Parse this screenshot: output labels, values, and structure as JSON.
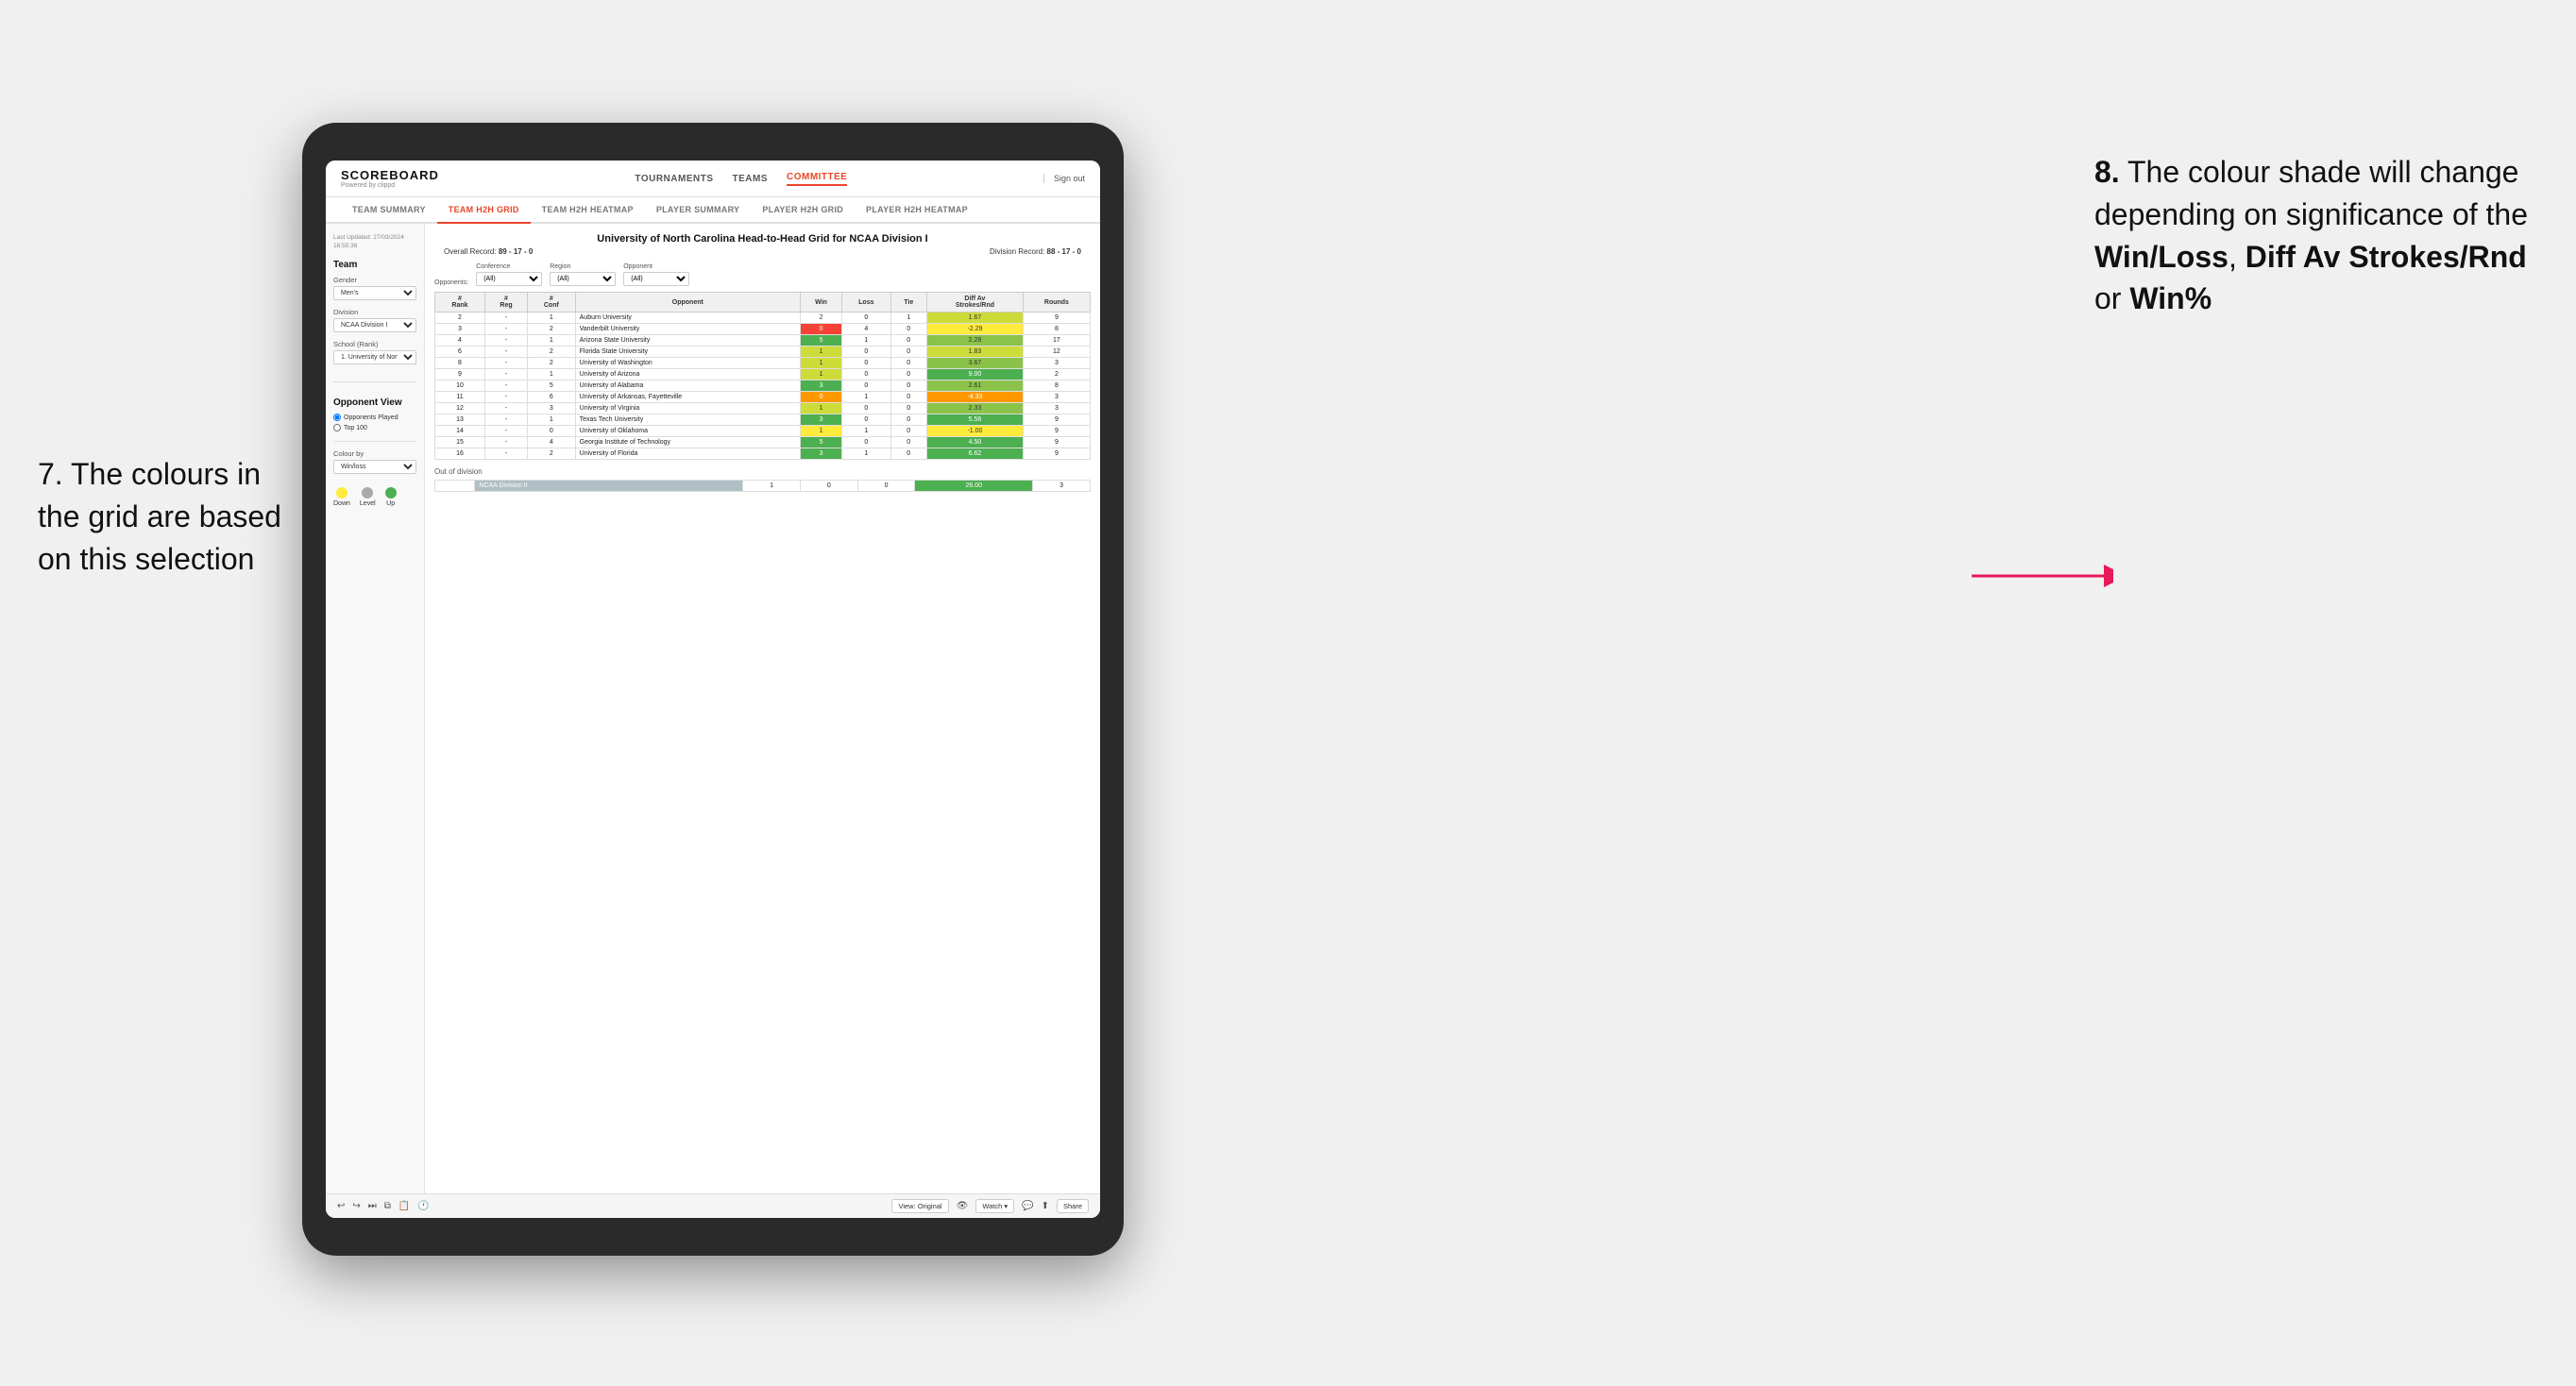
{
  "annotations": {
    "left": {
      "number": "7.",
      "text": "The colours in the grid are based on this selection"
    },
    "right": {
      "number": "8.",
      "text": "The colour shade will change depending on significance of the ",
      "bold_items": [
        "Win/Loss",
        "Diff Av Strokes/Rnd",
        "Win%"
      ]
    }
  },
  "app": {
    "brand": "SCOREBOARD",
    "brand_sub": "Powered by clippd",
    "nav": [
      "TOURNAMENTS",
      "TEAMS",
      "COMMITTEE"
    ],
    "sign_out": "Sign out"
  },
  "sub_nav": {
    "items": [
      "TEAM SUMMARY",
      "TEAM H2H GRID",
      "TEAM H2H HEATMAP",
      "PLAYER SUMMARY",
      "PLAYER H2H GRID",
      "PLAYER H2H HEATMAP"
    ],
    "active": "TEAM H2H GRID"
  },
  "sidebar": {
    "last_updated_label": "Last Updated: 27/03/2024",
    "last_updated_time": "16:55:38",
    "team_section": "Team",
    "gender_label": "Gender",
    "gender_value": "Men's",
    "division_label": "Division",
    "division_value": "NCAA Division I",
    "school_label": "School (Rank)",
    "school_value": "1. University of Nort...",
    "opponent_view_label": "Opponent View",
    "opponent_played": "Opponents Played",
    "opponent_top100": "Top 100",
    "colour_by_label": "Colour by",
    "colour_by_value": "Win/loss",
    "colour_legend": {
      "down": "Down",
      "level": "Level",
      "up": "Up"
    }
  },
  "grid": {
    "title": "University of North Carolina Head-to-Head Grid for NCAA Division I",
    "overall_record_label": "Overall Record:",
    "overall_record": "89 - 17 - 0",
    "division_record_label": "Division Record:",
    "division_record": "88 - 17 - 0",
    "filters": {
      "opponents_label": "Opponents:",
      "conference_label": "Conference",
      "conference_value": "(All)",
      "region_label": "Region",
      "region_value": "(All)",
      "opponent_label": "Opponent",
      "opponent_value": "(All)"
    },
    "columns": [
      "#\nRank",
      "#\nReg",
      "#\nConf",
      "Opponent",
      "Win",
      "Loss",
      "Tie",
      "Diff Av\nStrokes/Rnd",
      "Rounds"
    ],
    "rows": [
      {
        "rank": "2",
        "reg": "-",
        "conf": "1",
        "team": "Auburn University",
        "win": "2",
        "loss": "0",
        "tie": "1",
        "diff": "1.67",
        "rounds": "9",
        "win_color": "white",
        "diff_color": "green_light"
      },
      {
        "rank": "3",
        "reg": "-",
        "conf": "2",
        "team": "Vanderbilt University",
        "win": "0",
        "loss": "4",
        "tie": "0",
        "diff": "-2.29",
        "rounds": "8",
        "win_color": "red",
        "diff_color": "yellow"
      },
      {
        "rank": "4",
        "reg": "-",
        "conf": "1",
        "team": "Arizona State University",
        "win": "5",
        "loss": "1",
        "tie": "0",
        "diff": "2.28",
        "rounds": "17",
        "win_color": "green_dark",
        "diff_color": "green_med"
      },
      {
        "rank": "6",
        "reg": "-",
        "conf": "2",
        "team": "Florida State University",
        "win": "1",
        "loss": "0",
        "tie": "0",
        "diff": "1.83",
        "rounds": "12",
        "win_color": "green_light",
        "diff_color": "green_light"
      },
      {
        "rank": "8",
        "reg": "-",
        "conf": "2",
        "team": "University of Washington",
        "win": "1",
        "loss": "0",
        "tie": "0",
        "diff": "3.67",
        "rounds": "3",
        "win_color": "green_light",
        "diff_color": "green_med"
      },
      {
        "rank": "9",
        "reg": "-",
        "conf": "1",
        "team": "University of Arizona",
        "win": "1",
        "loss": "0",
        "tie": "0",
        "diff": "9.00",
        "rounds": "2",
        "win_color": "green_light",
        "diff_color": "green_dark"
      },
      {
        "rank": "10",
        "reg": "-",
        "conf": "5",
        "team": "University of Alabama",
        "win": "3",
        "loss": "0",
        "tie": "0",
        "diff": "2.61",
        "rounds": "8",
        "win_color": "green_dark",
        "diff_color": "green_med"
      },
      {
        "rank": "11",
        "reg": "-",
        "conf": "6",
        "team": "University of Arkansas, Fayetteville",
        "win": "0",
        "loss": "1",
        "tie": "0",
        "diff": "-4.33",
        "rounds": "3",
        "win_color": "orange",
        "diff_color": "orange"
      },
      {
        "rank": "12",
        "reg": "-",
        "conf": "3",
        "team": "University of Virginia",
        "win": "1",
        "loss": "0",
        "tie": "0",
        "diff": "2.33",
        "rounds": "3",
        "win_color": "green_light",
        "diff_color": "green_med"
      },
      {
        "rank": "13",
        "reg": "-",
        "conf": "1",
        "team": "Texas Tech University",
        "win": "3",
        "loss": "0",
        "tie": "0",
        "diff": "5.56",
        "rounds": "9",
        "win_color": "green_dark",
        "diff_color": "green_dark"
      },
      {
        "rank": "14",
        "reg": "-",
        "conf": "0",
        "team": "University of Oklahoma",
        "win": "1",
        "loss": "1",
        "tie": "0",
        "diff": "-1.00",
        "rounds": "9",
        "win_color": "yellow",
        "diff_color": "yellow"
      },
      {
        "rank": "15",
        "reg": "-",
        "conf": "4",
        "team": "Georgia Institute of Technology",
        "win": "5",
        "loss": "0",
        "tie": "0",
        "diff": "4.50",
        "rounds": "9",
        "win_color": "green_dark",
        "diff_color": "green_dark"
      },
      {
        "rank": "16",
        "reg": "-",
        "conf": "2",
        "team": "University of Florida",
        "win": "3",
        "loss": "1",
        "tie": "0",
        "diff": "6.62",
        "rounds": "9",
        "win_color": "green_dark",
        "diff_color": "green_dark"
      }
    ],
    "out_of_division": {
      "label": "Out of division",
      "rows": [
        {
          "division": "NCAA Division II",
          "win": "1",
          "loss": "0",
          "tie": "0",
          "diff": "26.00",
          "rounds": "3",
          "diff_color": "green_dark"
        }
      ]
    }
  },
  "toolbar": {
    "view_label": "View: Original",
    "watch_label": "Watch ▾",
    "share_label": "Share"
  }
}
